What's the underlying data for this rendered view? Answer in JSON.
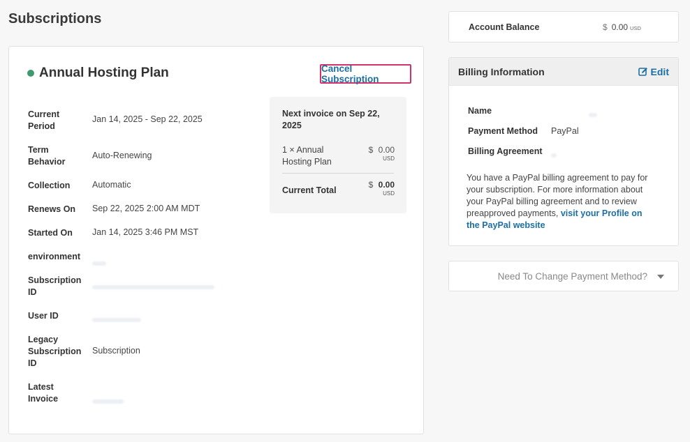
{
  "page": {
    "title": "Subscriptions"
  },
  "plan": {
    "name": "Annual Hosting Plan",
    "status_color": "#3f9a6f",
    "cancel_label": "Cancel Subscription"
  },
  "details": {
    "current_period": {
      "label": "Current Period",
      "value": "Jan 14, 2025 - Sep 22, 2025"
    },
    "term_behavior": {
      "label": "Term Behavior",
      "value": "Auto-Renewing"
    },
    "collection": {
      "label": "Collection",
      "value": "Automatic"
    },
    "renews_on": {
      "label": "Renews On",
      "value": "Sep 22, 2025 2:00 AM MDT"
    },
    "started_on": {
      "label": "Started On",
      "value": "Jan 14, 2025 3:46 PM MST"
    },
    "environment": {
      "label": "environment"
    },
    "subscription_id": {
      "label": "Subscription ID"
    },
    "user_id": {
      "label": "User ID"
    },
    "legacy_subscription_id": {
      "label": "Legacy Subscription ID",
      "value": "Subscription"
    },
    "latest_invoice": {
      "label": "Latest Invoice"
    }
  },
  "invoice": {
    "title": "Next invoice on Sep 22, 2025",
    "line_item": "1 ×  Annual Hosting Plan",
    "line_currency_symbol": "$",
    "line_amount": "0.00",
    "line_currency": "USD",
    "total_label": "Current Total",
    "total_currency_symbol": "$",
    "total_amount": "0.00",
    "total_currency": "USD"
  },
  "account": {
    "balance_label": "Account Balance",
    "currency_symbol": "$",
    "balance_amount": "0.00",
    "currency": "USD"
  },
  "billing": {
    "title": "Billing Information",
    "edit_label": "Edit",
    "name_label": "Name",
    "payment_method_label": "Payment Method",
    "payment_method_value": "PayPal",
    "billing_agreement_label": "Billing Agreement",
    "note_text": "You have a PayPal billing agreement to pay for your subscription. For more information about your PayPal billing agreement and to review preapproved payments, ",
    "note_link": "visit your Profile on the PayPal website"
  },
  "change_payment": {
    "label": "Need To Change Payment Method?"
  }
}
